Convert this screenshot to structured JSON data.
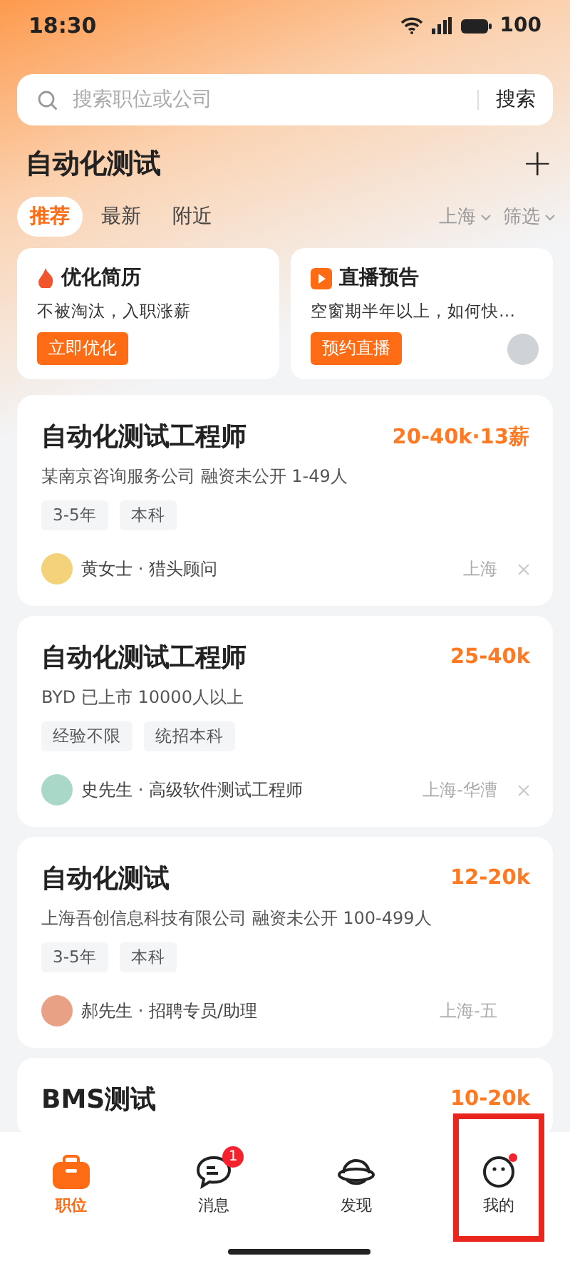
{
  "status_bar": {
    "time": "18:30",
    "battery": "100"
  },
  "search": {
    "placeholder": "搜索职位或公司",
    "button": "搜索"
  },
  "header": {
    "title": "自动化测试",
    "add": "+"
  },
  "tabs": [
    {
      "label": "推荐",
      "selected": true
    },
    {
      "label": "最新",
      "selected": false
    },
    {
      "label": "附近",
      "selected": false
    }
  ],
  "filters": [
    "上海",
    "筛选"
  ],
  "promos": [
    {
      "kind": "flame",
      "title": "优化简历",
      "subtitle": "不被淘汰，入职涨薪",
      "button": "立即优化",
      "avatar": false
    },
    {
      "kind": "play",
      "title": "直播预告",
      "subtitle": "空窗期半年以上，如何快…",
      "button": "预约直播",
      "avatar": true
    }
  ],
  "jobs": [
    {
      "title": "自动化测试工程师",
      "salary": "20-40k·13薪",
      "company": "某南京咨询服务公司  融资未公开  1-49人",
      "tags": [
        "3-5年",
        "本科"
      ],
      "recruiter": "黄女士 · 猎头顾问",
      "color": "#f3d27a",
      "location": "上海",
      "closable": true
    },
    {
      "title": "自动化测试工程师",
      "salary": "25-40k",
      "company": "BYD  已上市  10000人以上",
      "tags": [
        "经验不限",
        "统招本科"
      ],
      "recruiter": "史先生 · 高级软件测试工程师",
      "color": "#a9d8c8",
      "location": "上海-华漕",
      "closable": true
    },
    {
      "title": "自动化测试",
      "salary": "12-20k",
      "company": "上海吾创信息科技有限公司  融资未公开  100-499人",
      "tags": [
        "3-5年",
        "本科"
      ],
      "recruiter": "郝先生 · 招聘专员/助理",
      "color": "#e8a184",
      "location": "上海-五",
      "closable": false
    },
    {
      "title": "BMS测试",
      "salary": "10-20k"
    }
  ],
  "nav": [
    {
      "kind": "briefcase",
      "label": "职位",
      "selected": true,
      "dot": false
    },
    {
      "kind": "chat",
      "label": "消息",
      "selected": false,
      "badge": "1",
      "dot": false
    },
    {
      "kind": "planet",
      "label": "发现",
      "selected": false,
      "dot": false
    },
    {
      "kind": "face",
      "label": "我的",
      "selected": false,
      "dot": true,
      "highlighted": true
    }
  ]
}
